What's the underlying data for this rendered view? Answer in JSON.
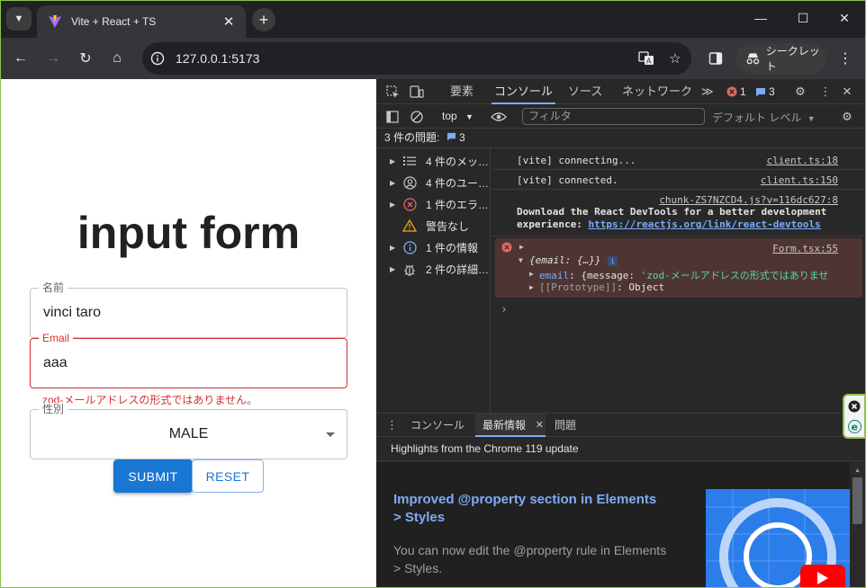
{
  "browser": {
    "tab_title": "Vite + React + TS",
    "url": "127.0.0.1:5173",
    "incognito_label": "シークレット"
  },
  "page": {
    "title": "input form",
    "name_field": {
      "label": "名前",
      "value": "vinci taro"
    },
    "email_field": {
      "label": "Email",
      "value": "aaa",
      "error": "zod-メールアドレスの形式ではありません。"
    },
    "gender_field": {
      "label": "性別",
      "value": "MALE"
    },
    "submit_label": "SUBMIT",
    "reset_label": "RESET"
  },
  "devtools": {
    "tabs": [
      "要素",
      "コンソール",
      "ソース",
      "ネットワーク"
    ],
    "more": "≫",
    "error_count": "1",
    "message_count": "3",
    "context": "top",
    "filter_placeholder": "フィルタ",
    "log_level": "デフォルト レベル",
    "issues_label": "3 件の問題:",
    "issues_count": "3",
    "sidebar": [
      {
        "label": "4 件のメッ…"
      },
      {
        "label": "4 件のユー…"
      },
      {
        "label": "1 件のエラ…"
      },
      {
        "label": "警告なし"
      },
      {
        "label": "1 件の情報"
      },
      {
        "label": "2 件の詳細…"
      }
    ],
    "logs": {
      "l1_text": "[vite] connecting...",
      "l1_src": "client.ts:18",
      "l2_text": "[vite] connected.",
      "l2_src": "client.ts:150",
      "l3_src": "chunk-ZS7NZCD4.js?v=116dc627:8",
      "l3_line1": "Download the React DevTools for a better development",
      "l3_line2_prefix": "experience: ",
      "l3_link": "https://reactjs.org/link/react-devtools",
      "err_src": "Form.tsx:55",
      "err_obj": "{email: {…}}",
      "err_key": "email",
      "err_val_prefix": ": {message: ",
      "err_val": "'zod-メールアドレスの形式ではありませ",
      "proto_key": "[[Prototype]]",
      "proto_val": ": Object",
      "prompt": "›"
    },
    "drawer_tabs": [
      "コンソール",
      "最新情報",
      "問題"
    ],
    "whats_new_header": "Highlights from the Chrome 119 update",
    "whats_new_title": "Improved @property section in Elements > Styles",
    "whats_new_desc": "You can now edit the @property rule in Elements > Styles."
  }
}
